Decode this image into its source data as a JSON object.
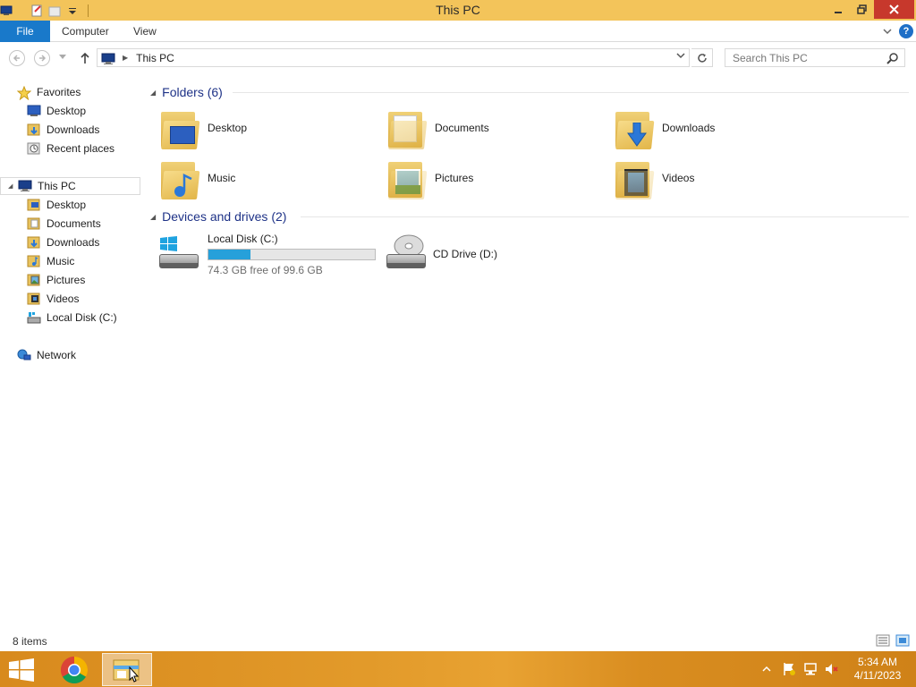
{
  "window": {
    "title": "This PC"
  },
  "ribbon": {
    "tabs": [
      "File",
      "Computer",
      "View"
    ],
    "help": "?"
  },
  "navbar": {
    "address": "This PC",
    "search_placeholder": "Search This PC"
  },
  "navpane": {
    "favorites": {
      "label": "Favorites",
      "items": [
        "Desktop",
        "Downloads",
        "Recent places"
      ]
    },
    "thispc": {
      "label": "This PC",
      "items": [
        "Desktop",
        "Documents",
        "Downloads",
        "Music",
        "Pictures",
        "Videos",
        "Local Disk (C:)"
      ]
    },
    "network": {
      "label": "Network"
    }
  },
  "content": {
    "folders_header": "Folders (6)",
    "folders": [
      "Desktop",
      "Documents",
      "Downloads",
      "Music",
      "Pictures",
      "Videos"
    ],
    "devices_header": "Devices and drives (2)",
    "drives": [
      {
        "name": "Local Disk (C:)",
        "free_text": "74.3 GB free of 99.6 GB",
        "used_fraction": 0.254
      },
      {
        "name": "CD Drive (D:)"
      }
    ]
  },
  "statusbar": {
    "item_count": "8 items"
  },
  "taskbar": {
    "time": "5:34 AM",
    "date": "4/11/2023"
  },
  "colors": {
    "titlebar": "#f3c45a",
    "file_tab": "#1979ca",
    "close_button": "#c7382c",
    "group_header": "#1e3287",
    "drive_fill": "#26a0da",
    "taskbar": "#e29a2a"
  }
}
